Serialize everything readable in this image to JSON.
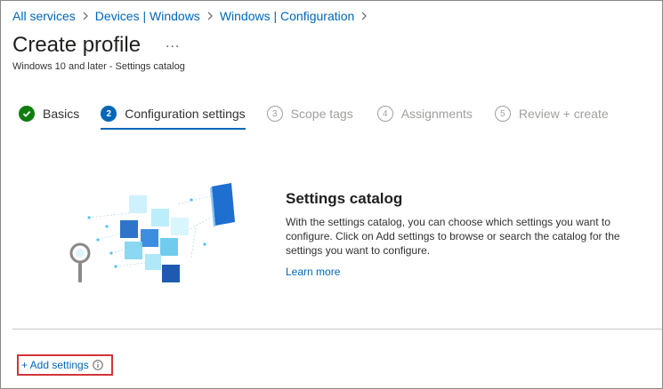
{
  "breadcrumb": [
    {
      "label": "All services"
    },
    {
      "label": "Devices | Windows"
    },
    {
      "label": "Windows | Configuration"
    }
  ],
  "header": {
    "title": "Create profile",
    "more_label": "...",
    "subtitle": "Windows 10 and later - Settings catalog"
  },
  "steps": [
    {
      "number": "",
      "label": "Basics",
      "state": "done"
    },
    {
      "number": "2",
      "label": "Configuration settings",
      "state": "current"
    },
    {
      "number": "3",
      "label": "Scope tags",
      "state": "future"
    },
    {
      "number": "4",
      "label": "Assignments",
      "state": "future"
    },
    {
      "number": "5",
      "label": "Review + create",
      "state": "future"
    }
  ],
  "catalog": {
    "title": "Settings catalog",
    "description": "With the settings catalog, you can choose which settings you want to configure. Click on Add settings to browse or search the catalog for the settings you want to configure.",
    "learn_more": "Learn more"
  },
  "actions": {
    "add_settings": "+ Add settings"
  },
  "icons": {
    "breadcrumb_separator": "chevron-right-icon",
    "step_done": "checkmark-icon",
    "info": "info-icon",
    "illustration": "settings-catalog-illustration"
  },
  "colors": {
    "accent": "#0067b8",
    "success": "#107c10",
    "highlight_border": "#d13438"
  }
}
